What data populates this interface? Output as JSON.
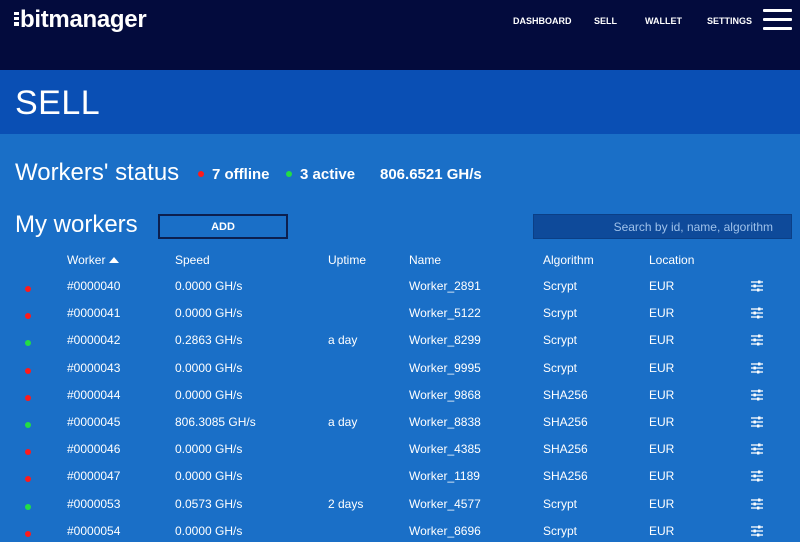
{
  "header": {
    "logo": "bitmanager",
    "nav": [
      {
        "label": "DASHBOARD"
      },
      {
        "label": "SELL"
      },
      {
        "label": "WALLET"
      },
      {
        "label": "SETTINGS"
      }
    ],
    "menu_icon": "hamburger-icon"
  },
  "page": {
    "title": "SELL"
  },
  "status": {
    "title": "Workers' status",
    "offline": "7 offline",
    "active": "3 active",
    "hashrate": "806.6521 GH/s"
  },
  "workers": {
    "title": "My workers",
    "add_label": "ADD",
    "search_placeholder": "Search by id, name, algorithm",
    "columns": [
      "Worker",
      "Speed",
      "Uptime",
      "Name",
      "Algorithm",
      "Location"
    ],
    "rows": [
      {
        "status": "offline",
        "id": "#0000040",
        "speed": "0.0000 GH/s",
        "uptime": "",
        "name": "Worker_2891",
        "algorithm": "Scrypt",
        "location": "EUR"
      },
      {
        "status": "offline",
        "id": "#0000041",
        "speed": "0.0000 GH/s",
        "uptime": "",
        "name": "Worker_5122",
        "algorithm": "Scrypt",
        "location": "EUR"
      },
      {
        "status": "active",
        "id": "#0000042",
        "speed": "0.2863 GH/s",
        "uptime": "a day",
        "name": "Worker_8299",
        "algorithm": "Scrypt",
        "location": "EUR"
      },
      {
        "status": "offline",
        "id": "#0000043",
        "speed": "0.0000 GH/s",
        "uptime": "",
        "name": "Worker_9995",
        "algorithm": "Scrypt",
        "location": "EUR"
      },
      {
        "status": "offline",
        "id": "#0000044",
        "speed": "0.0000 GH/s",
        "uptime": "",
        "name": "Worker_9868",
        "algorithm": "SHA256",
        "location": "EUR"
      },
      {
        "status": "active",
        "id": "#0000045",
        "speed": "806.3085 GH/s",
        "uptime": "a day",
        "name": "Worker_8838",
        "algorithm": "SHA256",
        "location": "EUR"
      },
      {
        "status": "offline",
        "id": "#0000046",
        "speed": "0.0000 GH/s",
        "uptime": "",
        "name": "Worker_4385",
        "algorithm": "SHA256",
        "location": "EUR"
      },
      {
        "status": "offline",
        "id": "#0000047",
        "speed": "0.0000 GH/s",
        "uptime": "",
        "name": "Worker_1189",
        "algorithm": "SHA256",
        "location": "EUR"
      },
      {
        "status": "active",
        "id": "#0000053",
        "speed": "0.0573 GH/s",
        "uptime": "2 days",
        "name": "Worker_4577",
        "algorithm": "Scrypt",
        "location": "EUR"
      },
      {
        "status": "offline",
        "id": "#0000054",
        "speed": "0.0000 GH/s",
        "uptime": "",
        "name": "Worker_8696",
        "algorithm": "Scrypt",
        "location": "EUR"
      }
    ]
  },
  "colors": {
    "topbar": "#030b3d",
    "titlebar": "#0a4fb4",
    "background": "#1a6fc7",
    "offline": "#ff1a1a",
    "active": "#22dd44"
  },
  "icons": {
    "status": "status-dot-icon",
    "sort": "sort-ascending-icon",
    "row_settings": "sliders-icon"
  }
}
